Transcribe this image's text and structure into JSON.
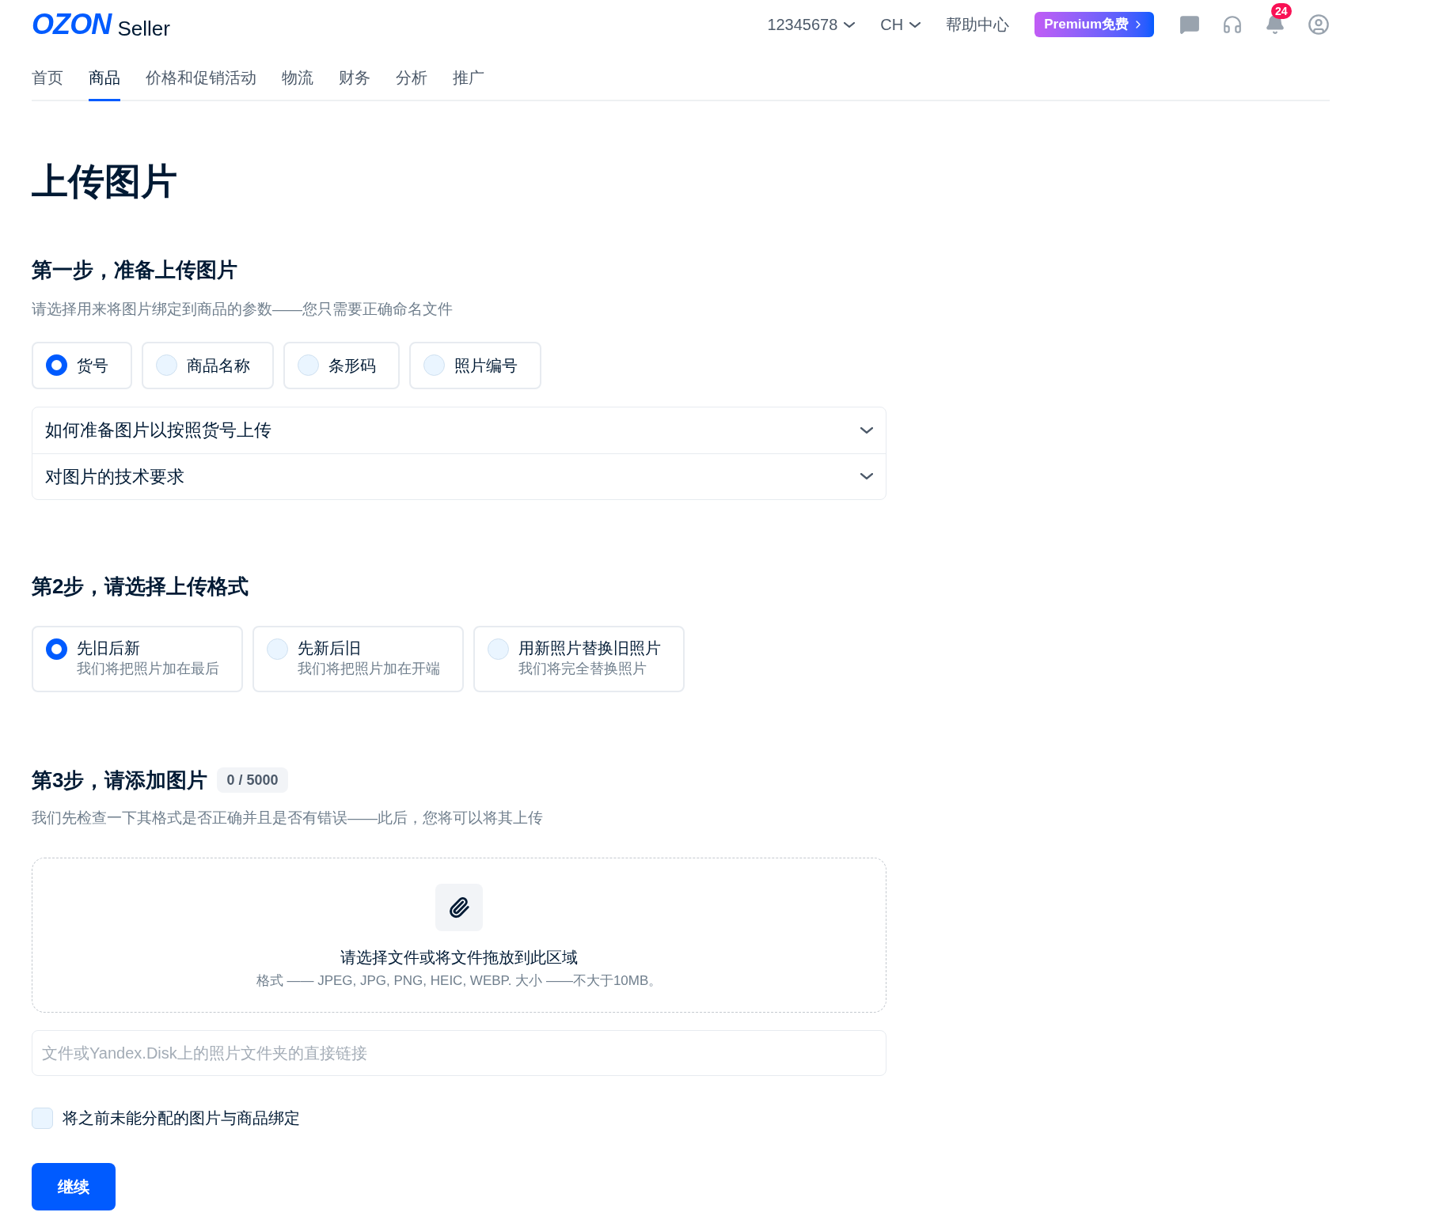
{
  "header": {
    "logo": "OZON",
    "logo_suffix": "Seller",
    "account": "12345678",
    "language": "CH",
    "help": "帮助中心",
    "premium": "Premium免费",
    "notification_count": "24"
  },
  "nav": [
    {
      "label": "首页",
      "selected": false
    },
    {
      "label": "商品",
      "selected": true
    },
    {
      "label": "价格和促销活动",
      "selected": false
    },
    {
      "label": "物流",
      "selected": false
    },
    {
      "label": "财务",
      "selected": false
    },
    {
      "label": "分析",
      "selected": false
    },
    {
      "label": "推广",
      "selected": false
    }
  ],
  "title": "上传图片",
  "step1": {
    "heading": "第一步，准备上传图片",
    "description": "请选择用来将图片绑定到商品的参数——您只需要正确命名文件",
    "options": [
      {
        "label": "货号",
        "selected": true
      },
      {
        "label": "商品名称",
        "selected": false
      },
      {
        "label": "条形码",
        "selected": false
      },
      {
        "label": "照片编号",
        "selected": false
      }
    ],
    "accordion": [
      {
        "title": "如何准备图片以按照货号上传",
        "expanded": false
      },
      {
        "title": "对图片的技术要求",
        "expanded": false
      }
    ]
  },
  "step2": {
    "heading": "第2步，请选择上传格式",
    "options": [
      {
        "title": "先旧后新",
        "description": "我们将把照片加在最后",
        "selected": true
      },
      {
        "title": "先新后旧",
        "description": "我们将把照片加在开端",
        "selected": false
      },
      {
        "title": "用新照片替换旧照片",
        "description": "我们将完全替换照片",
        "selected": false
      }
    ]
  },
  "step3": {
    "heading": "第3步，请添加图片",
    "counter": "0 / 5000",
    "description": "我们先检查一下其格式是否正确并且是否有错误——此后，您将可以将其上传",
    "dropzone": {
      "title": "请选择文件或将文件拖放到此区域",
      "formats": "格式 —— JPEG, JPG, PNG, HEIC, WEBP. 大小 ——不大于10MB。"
    },
    "link_field": {
      "placeholder": "文件或Yandex.Disk上的照片文件夹的直接链接"
    },
    "checkbox": {
      "label": "将之前未能分配的图片与商品绑定",
      "checked": false
    },
    "button": "继续"
  }
}
